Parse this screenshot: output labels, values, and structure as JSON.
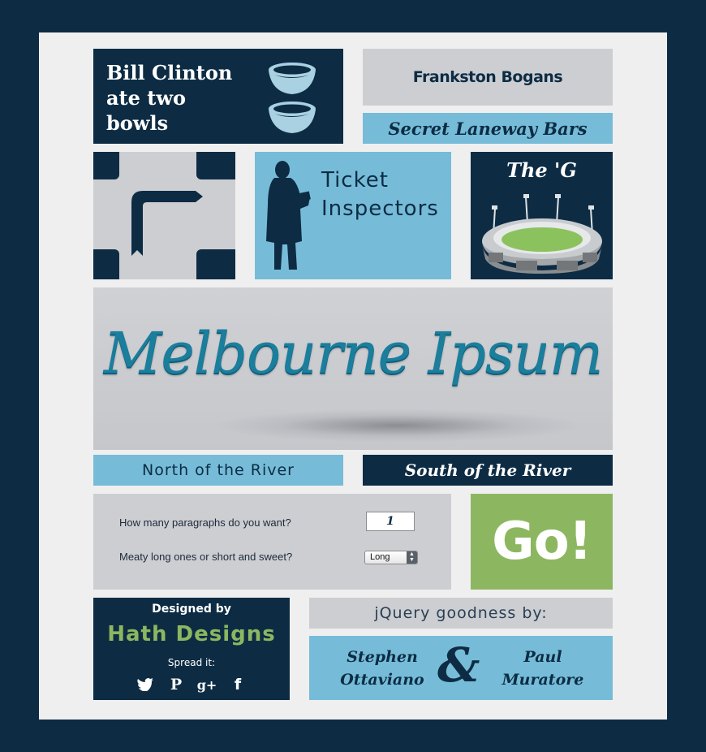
{
  "tiles": {
    "clinton": {
      "line1": "Bill Clinton",
      "line2": "ate two",
      "line3": "bowls"
    },
    "bogans": "Frankston Bogans",
    "laneway": "Secret Laneway Bars",
    "ticket": {
      "line1": "Ticket",
      "line2": "Inspectors"
    },
    "theg": "The 'G"
  },
  "hero": {
    "title": "Melbourne Ipsum"
  },
  "regions": {
    "north": "North of the River",
    "south": "South of the River"
  },
  "form": {
    "paragraphs_label": "How many paragraphs do you want?",
    "paragraphs_value": "1",
    "length_label": "Meaty long ones or short and sweet?",
    "length_value": "Long",
    "go_label": "Go!"
  },
  "footer": {
    "designed_by": "Designed by",
    "designer": "Hath Designs",
    "spread": "Spread it:",
    "jquery": "jQuery goodness by:",
    "credit1": {
      "first": "Stephen",
      "last": "Ottaviano"
    },
    "amp": "&",
    "credit2": {
      "first": "Paul",
      "last": "Muratore"
    }
  },
  "icons": [
    "bowl-icon",
    "road-arrow-icon",
    "inspector-silhouette-icon",
    "stadium-icon",
    "twitter-icon",
    "pinterest-icon",
    "google-plus-icon",
    "facebook-icon"
  ],
  "colors": {
    "navy": "#0d2c44",
    "light_blue": "#76bcd8",
    "grey": "#cdced2",
    "green": "#8cb760",
    "hero_text": "#1a7e9c"
  }
}
